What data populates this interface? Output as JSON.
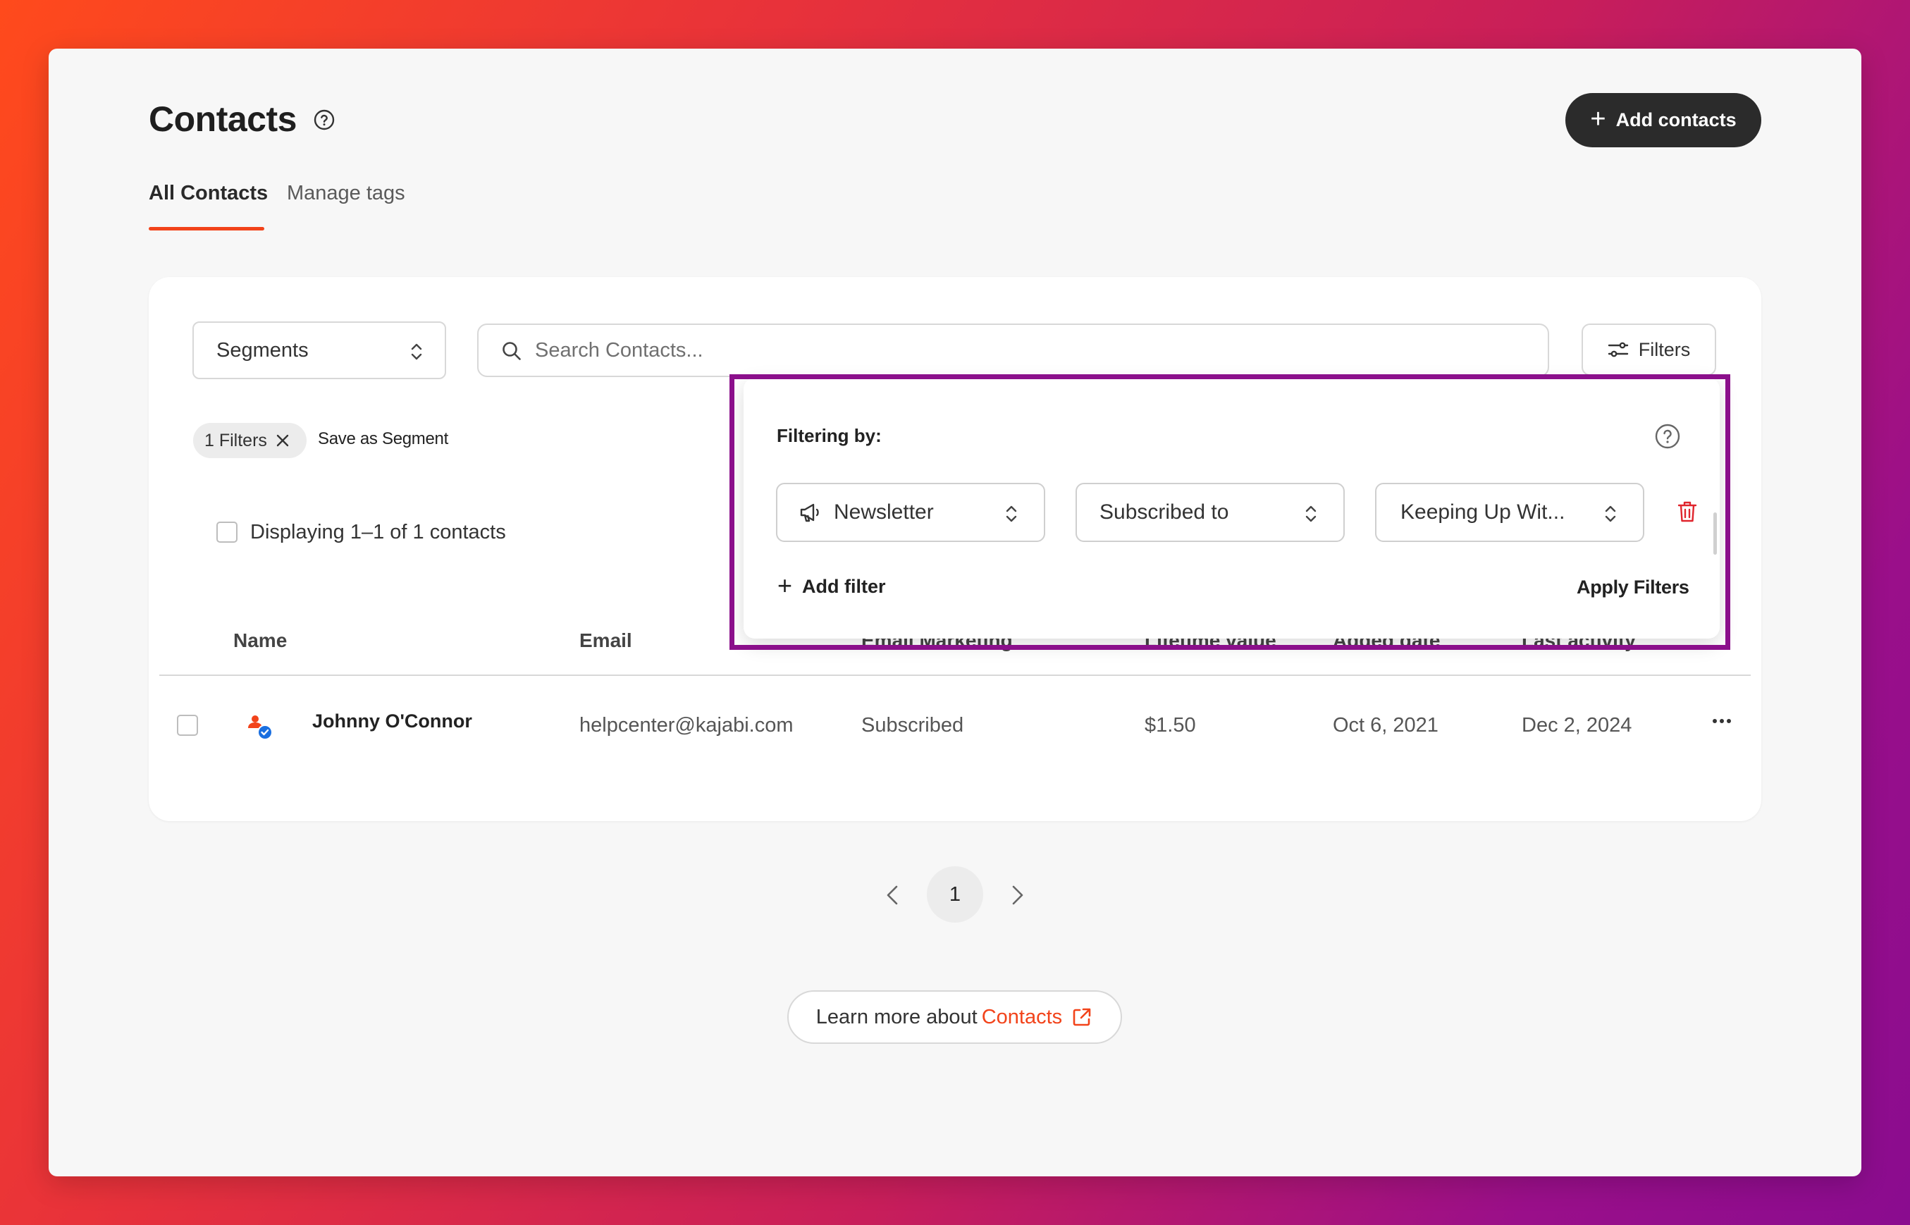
{
  "header": {
    "title": "Contacts",
    "add_contacts_label": "Add contacts"
  },
  "tabs": [
    {
      "label": "All Contacts",
      "active": true
    },
    {
      "label": "Manage tags",
      "active": false
    }
  ],
  "toolbar": {
    "segments_label": "Segments",
    "search_placeholder": "Search Contacts...",
    "filters_label": "Filters"
  },
  "active_filters": {
    "chip_label": "1 Filters",
    "save_segment_label": "Save as Segment"
  },
  "summary": {
    "displaying_text": "Displaying 1–1 of 1 contacts"
  },
  "table": {
    "columns": [
      "Name",
      "Email",
      "Email Marketing",
      "Lifetime value",
      "Added date",
      "Last activity"
    ],
    "rows": [
      {
        "name": "Johnny O'Connor",
        "email": "helpcenter@kajabi.com",
        "email_marketing": "Subscribed",
        "lifetime_value": "$1.50",
        "added_date": "Oct 6, 2021",
        "last_activity": "Dec 2, 2024"
      }
    ]
  },
  "pagination": {
    "current_page": "1"
  },
  "learn_more": {
    "prefix": "Learn more about",
    "link_label": "Contacts"
  },
  "filter_popover": {
    "heading": "Filtering by:",
    "field": "Newsletter",
    "operator": "Subscribed to",
    "value": "Keeping Up Wit...",
    "add_filter_label": "Add filter",
    "apply_label": "Apply Filters"
  },
  "colors": {
    "accent": "#f2431a",
    "dark_button": "#2b2b2b",
    "highlight_border": "#8b0f8b",
    "delete_red": "#e0242c",
    "verified_blue": "#1a6fe0"
  }
}
